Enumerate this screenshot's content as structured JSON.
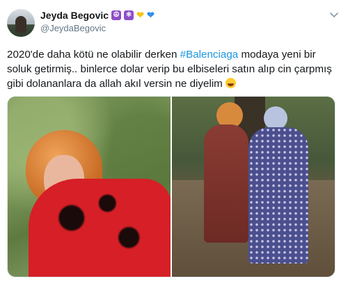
{
  "tweet": {
    "author_name": "Jeyda Begovic",
    "name_emojis": [
      "☮",
      "⚛"
    ],
    "handle": "@JeydaBegovic",
    "text_before": "2020'de daha kötü ne olabilir derken ",
    "hashtag": "#Balenciaga",
    "text_after": " modaya yeni bir soluk getirmiş.. binlerce dolar verip bu elbiseleri satın alıp cin çarpmış gibi dolananlara da allah akıl versin ne diyelim "
  },
  "icons": {
    "avatar": "profile-photo",
    "menu": "chevron-down-icon",
    "heart_yellow": "#f5c518",
    "heart_blue": "#2f8ff0",
    "hashtag_color": "#1b95e0"
  }
}
